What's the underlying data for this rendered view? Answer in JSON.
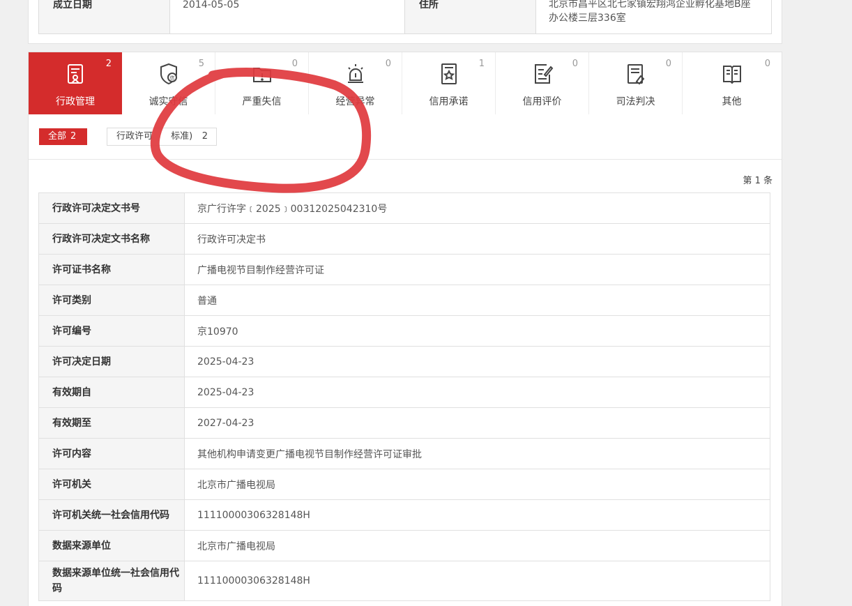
{
  "info": {
    "est_date_label": "成立日期",
    "est_date_value": "2014-05-05",
    "address_label": "住所",
    "address_line1": "北京市昌平区北七家镇宏翔鸿企业孵化基地B座",
    "address_line2": "办公楼三层336室"
  },
  "tabs": [
    {
      "label": "行政管理",
      "count": "2",
      "icon": "admin-doc-icon",
      "active": true
    },
    {
      "label": "诚实守信",
      "count": "5",
      "icon": "shield-credit-icon",
      "active": false
    },
    {
      "label": "严重失信",
      "count": "0",
      "icon": "folder-warning-icon",
      "active": false
    },
    {
      "label": "经营异常",
      "count": "0",
      "icon": "alarm-light-icon",
      "active": false
    },
    {
      "label": "信用承诺",
      "count": "1",
      "icon": "pledge-star-icon",
      "active": false
    },
    {
      "label": "信用评价",
      "count": "0",
      "icon": "evaluation-edit-icon",
      "active": false
    },
    {
      "label": "司法判决",
      "count": "0",
      "icon": "judgment-doc-icon",
      "active": false
    },
    {
      "label": "其他",
      "count": "0",
      "icon": "other-book-icon",
      "active": false
    }
  ],
  "filters": {
    "all_label": "全部",
    "all_count": "2",
    "chip_label": "行政许可",
    "chip_suffix": "标准)",
    "chip_count": "2"
  },
  "pager": "第 1 条",
  "details": [
    {
      "key": "行政许可决定文书号",
      "value": "京广行许字﹝2025﹞00312025042310号"
    },
    {
      "key": "行政许可决定文书名称",
      "value": "行政许可决定书"
    },
    {
      "key": "许可证书名称",
      "value": "广播电视节目制作经营许可证"
    },
    {
      "key": "许可类别",
      "value": "普通"
    },
    {
      "key": "许可编号",
      "value": "京10970"
    },
    {
      "key": "许可决定日期",
      "value": "2025-04-23"
    },
    {
      "key": "有效期自",
      "value": "2025-04-23"
    },
    {
      "key": "有效期至",
      "value": "2027-04-23"
    },
    {
      "key": "许可内容",
      "value": "其他机构申请变更广播电视节目制作经营许可证审批"
    },
    {
      "key": "许可机关",
      "value": "北京市广播电视局"
    },
    {
      "key": "许可机关统一社会信用代码",
      "value": "11110000306328148H"
    },
    {
      "key": "数据来源单位",
      "value": "北京市广播电视局"
    },
    {
      "key": "数据来源单位统一社会信用代码",
      "value": "11110000306328148H"
    }
  ],
  "colors": {
    "accent": "#d42c2c",
    "annotation": "#e03a3e"
  }
}
